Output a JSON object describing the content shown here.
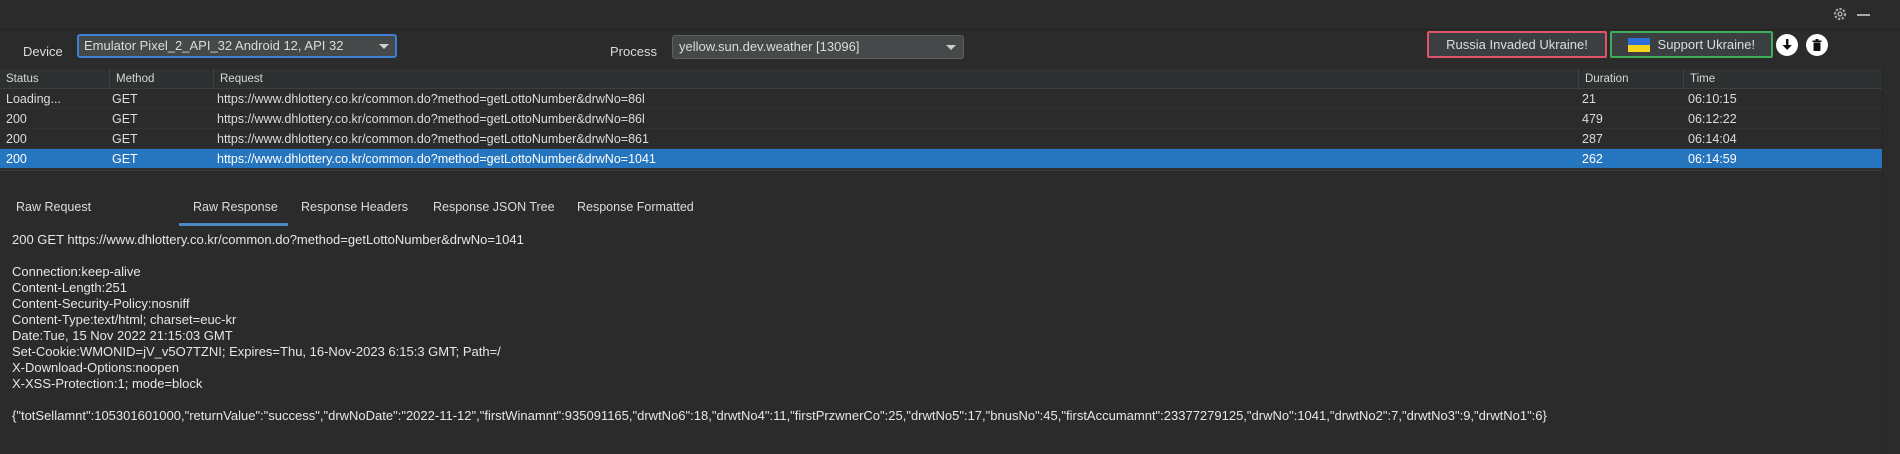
{
  "toolbar": {
    "device_label": "Device",
    "device_value": "Emulator Pixel_2_API_32 Android 12, API 32",
    "process_label": "Process",
    "process_value": "yellow.sun.dev.weather [13096]",
    "russia_button": "Russia Invaded Ukraine!",
    "support_button": "Support Ukraine!",
    "download_icon": "download-icon",
    "trash_icon": "trash-icon"
  },
  "window": {
    "settings_icon": "gear-icon",
    "minimize_icon": "minimize-icon"
  },
  "table": {
    "headers": [
      "Status",
      "Method",
      "Request",
      "Duration",
      "Time"
    ],
    "rows": [
      {
        "status": "Loading...",
        "method": "GET",
        "request": "https://www.dhlottery.co.kr/common.do?method=getLottoNumber&drwNo=86l",
        "duration": "21",
        "time": "06:10:15"
      },
      {
        "status": "200",
        "method": "GET",
        "request": "https://www.dhlottery.co.kr/common.do?method=getLottoNumber&drwNo=86l",
        "duration": "479",
        "time": "06:12:22"
      },
      {
        "status": "200",
        "method": "GET",
        "request": "https://www.dhlottery.co.kr/common.do?method=getLottoNumber&drwNo=861",
        "duration": "287",
        "time": "06:14:04"
      },
      {
        "status": "200",
        "method": "GET",
        "request": "https://www.dhlottery.co.kr/common.do?method=getLottoNumber&drwNo=1041",
        "duration": "262",
        "time": "06:14:59"
      }
    ],
    "selected_index": 3
  },
  "tabs": [
    "Raw Request",
    "Raw Response",
    "Response Headers",
    "Response JSON Tree",
    "Response Formatted"
  ],
  "active_tab": 1,
  "response": {
    "status_line": "200 GET https://www.dhlottery.co.kr/common.do?method=getLottoNumber&drwNo=1041",
    "headers": [
      "Connection:keep-alive",
      "Content-Length:251",
      "Content-Security-Policy:nosniff",
      "Content-Type:text/html; charset=euc-kr",
      "Date:Tue, 15 Nov 2022 21:15:03 GMT",
      "Set-Cookie:WMONID=jV_v5O7TZNI; Expires=Thu, 16-Nov-2023 6:15:3 GMT; Path=/",
      "X-Download-Options:noopen",
      "X-XSS-Protection:1; mode=block"
    ],
    "body": "{\"totSellamnt\":105301601000,\"returnValue\":\"success\",\"drwNoDate\":\"2022-11-12\",\"firstWinamnt\":935091165,\"drwtNo6\":18,\"drwtNo4\":11,\"firstPrzwnerCo\":25,\"drwtNo5\":17,\"bnusNo\":45,\"firstAccumamnt\":23377279125,\"drwNo\":1041,\"drwtNo2\":7,\"drwtNo3\":9,\"drwtNo1\":6}"
  }
}
